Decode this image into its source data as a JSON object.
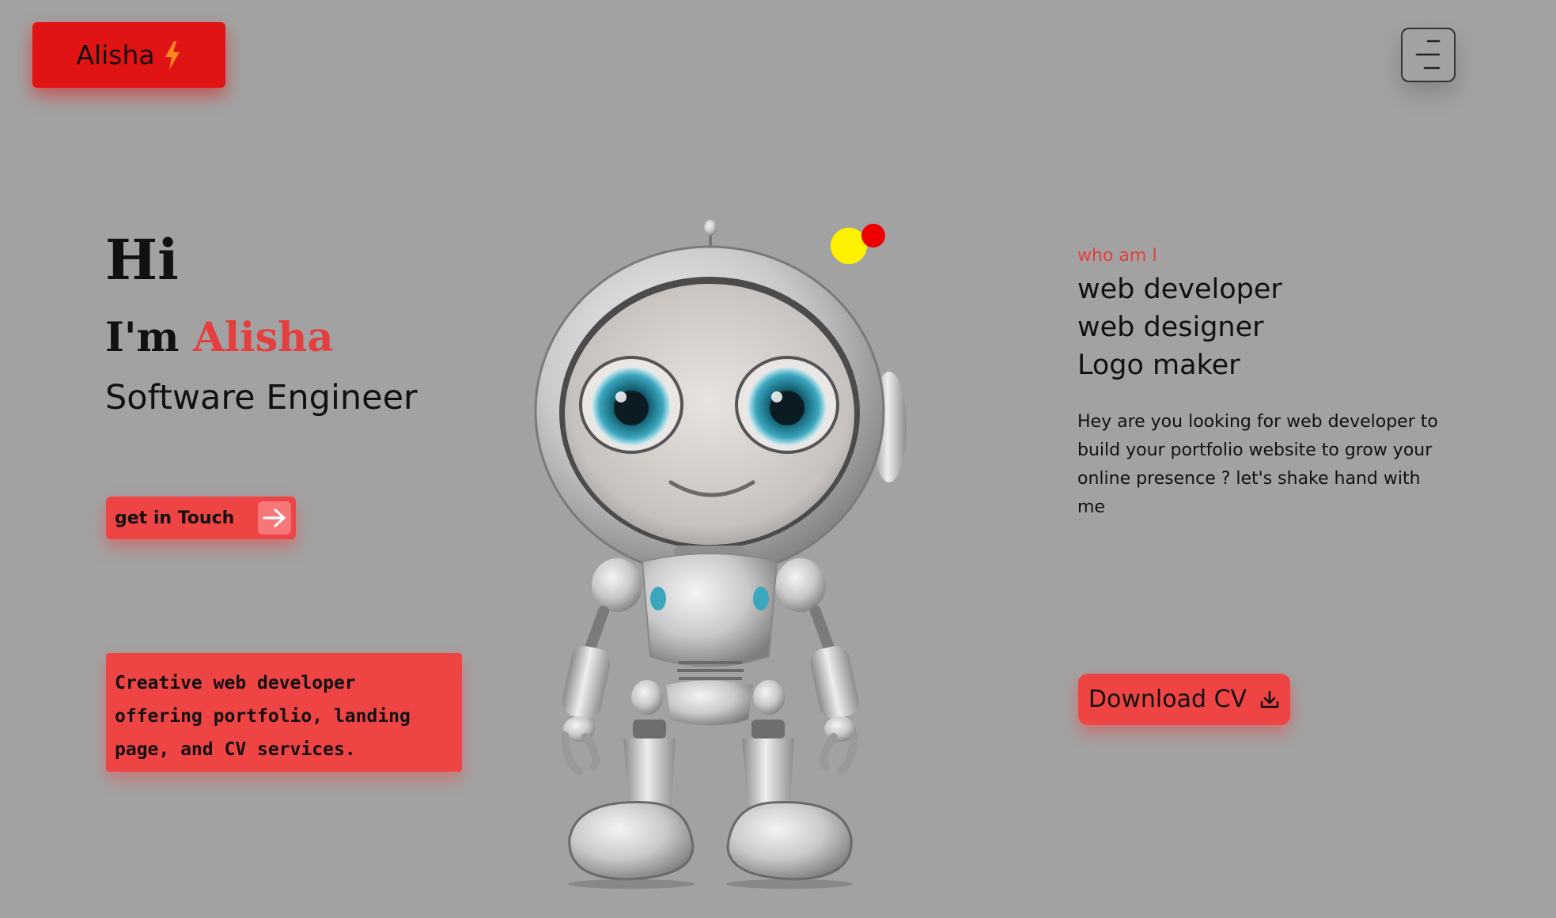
{
  "brand": {
    "name": "Alisha",
    "icon": "lightning-bolt-icon"
  },
  "menu": {
    "icon": "hamburger-menu-icon"
  },
  "hero": {
    "greeting": "Hi",
    "intro_prefix": "I'm",
    "name": "Alisha",
    "role": "Software Engineer",
    "cta_label": "get in Touch",
    "cta_icon": "arrow-right-icon"
  },
  "promo": {
    "text": "Creative web developer offering portfolio, landing page, and CV services."
  },
  "about": {
    "eyebrow": "who am I",
    "skills": [
      "web developer",
      "web designer",
      "Logo maker"
    ],
    "description": "Hey are you looking for web developer to build your portfolio website to grow your online presence ? let's shake hand with me",
    "download_label": "Download CV",
    "download_icon": "download-icon"
  },
  "decor": {
    "image": "robot-illustration",
    "dots": [
      "#fff200",
      "#ee0000"
    ]
  },
  "colors": {
    "background": "#a2a2a2",
    "brand_red": "#e01414",
    "accent": "#ef4444",
    "highlight_text": "#e53e3e"
  }
}
